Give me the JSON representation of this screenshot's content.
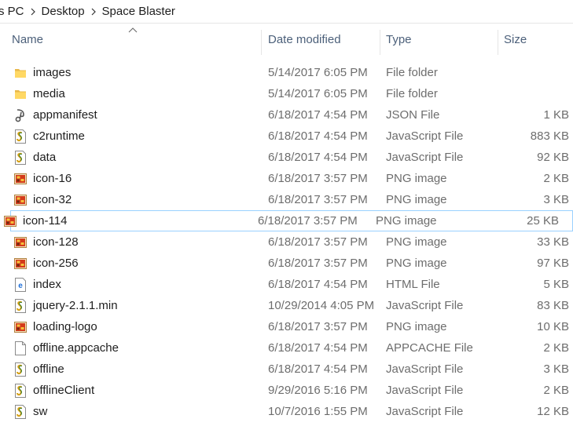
{
  "breadcrumb": {
    "items": [
      "s PC",
      "Desktop",
      "Space Blaster"
    ]
  },
  "columns": {
    "name": "Name",
    "date": "Date modified",
    "type": "Type",
    "size": "Size"
  },
  "files": [
    {
      "name": "images",
      "date": "5/14/2017 6:05 PM",
      "type": "File folder",
      "size": "",
      "icon": "folder-icon"
    },
    {
      "name": "media",
      "date": "5/14/2017 6:05 PM",
      "type": "File folder",
      "size": "",
      "icon": "folder-icon"
    },
    {
      "name": "appmanifest",
      "date": "6/18/2017 4:54 PM",
      "type": "JSON File",
      "size": "1 KB",
      "icon": "json-file-icon"
    },
    {
      "name": "c2runtime",
      "date": "6/18/2017 4:54 PM",
      "type": "JavaScript File",
      "size": "883 KB",
      "icon": "js-file-icon"
    },
    {
      "name": "data",
      "date": "6/18/2017 4:54 PM",
      "type": "JavaScript File",
      "size": "92 KB",
      "icon": "js-file-icon"
    },
    {
      "name": "icon-16",
      "date": "6/18/2017 3:57 PM",
      "type": "PNG image",
      "size": "2 KB",
      "icon": "png-image-icon"
    },
    {
      "name": "icon-32",
      "date": "6/18/2017 3:57 PM",
      "type": "PNG image",
      "size": "3 KB",
      "icon": "png-image-icon"
    },
    {
      "name": "icon-114",
      "date": "6/18/2017 3:57 PM",
      "type": "PNG image",
      "size": "25 KB",
      "icon": "png-image-icon",
      "focused": true
    },
    {
      "name": "icon-128",
      "date": "6/18/2017 3:57 PM",
      "type": "PNG image",
      "size": "33 KB",
      "icon": "png-image-icon"
    },
    {
      "name": "icon-256",
      "date": "6/18/2017 3:57 PM",
      "type": "PNG image",
      "size": "97 KB",
      "icon": "png-image-icon"
    },
    {
      "name": "index",
      "date": "6/18/2017 4:54 PM",
      "type": "HTML File",
      "size": "5 KB",
      "icon": "html-file-icon"
    },
    {
      "name": "jquery-2.1.1.min",
      "date": "10/29/2014 4:05 PM",
      "type": "JavaScript File",
      "size": "83 KB",
      "icon": "js-file-icon"
    },
    {
      "name": "loading-logo",
      "date": "6/18/2017 3:57 PM",
      "type": "PNG image",
      "size": "10 KB",
      "icon": "png-image-icon"
    },
    {
      "name": "offline.appcache",
      "date": "6/18/2017 4:54 PM",
      "type": "APPCACHE File",
      "size": "2 KB",
      "icon": "blank-file-icon"
    },
    {
      "name": "offline",
      "date": "6/18/2017 4:54 PM",
      "type": "JavaScript File",
      "size": "3 KB",
      "icon": "js-file-icon"
    },
    {
      "name": "offlineClient",
      "date": "9/29/2016 5:16 PM",
      "type": "JavaScript File",
      "size": "2 KB",
      "icon": "js-file-icon"
    },
    {
      "name": "sw",
      "date": "10/7/2016 1:55 PM",
      "type": "JavaScript File",
      "size": "12 KB",
      "icon": "js-file-icon"
    }
  ]
}
